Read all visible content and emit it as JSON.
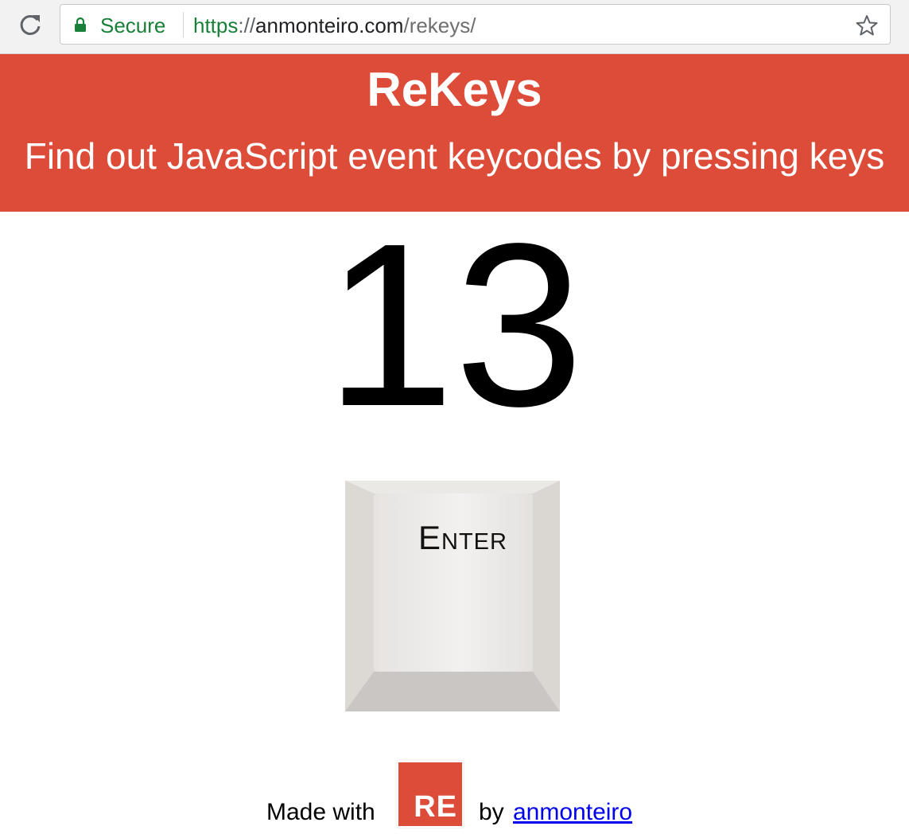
{
  "browser": {
    "secure_label": "Secure",
    "url_scheme": "https",
    "url_separator": "://",
    "url_host": "anmonteiro.com",
    "url_path": "/rekeys/",
    "icons": {
      "reload": "reload-icon",
      "lock": "lock-icon",
      "star": "star-icon"
    }
  },
  "header": {
    "title": "ReKeys",
    "subtitle": "Find out JavaScript event keycodes by pressing keys",
    "background_color": "#dd4b39"
  },
  "result": {
    "keycode": "13",
    "key_label": "Enter"
  },
  "footer": {
    "made_with": "Made with",
    "logo_text": "RE",
    "by": "by",
    "author": "anmonteiro"
  }
}
